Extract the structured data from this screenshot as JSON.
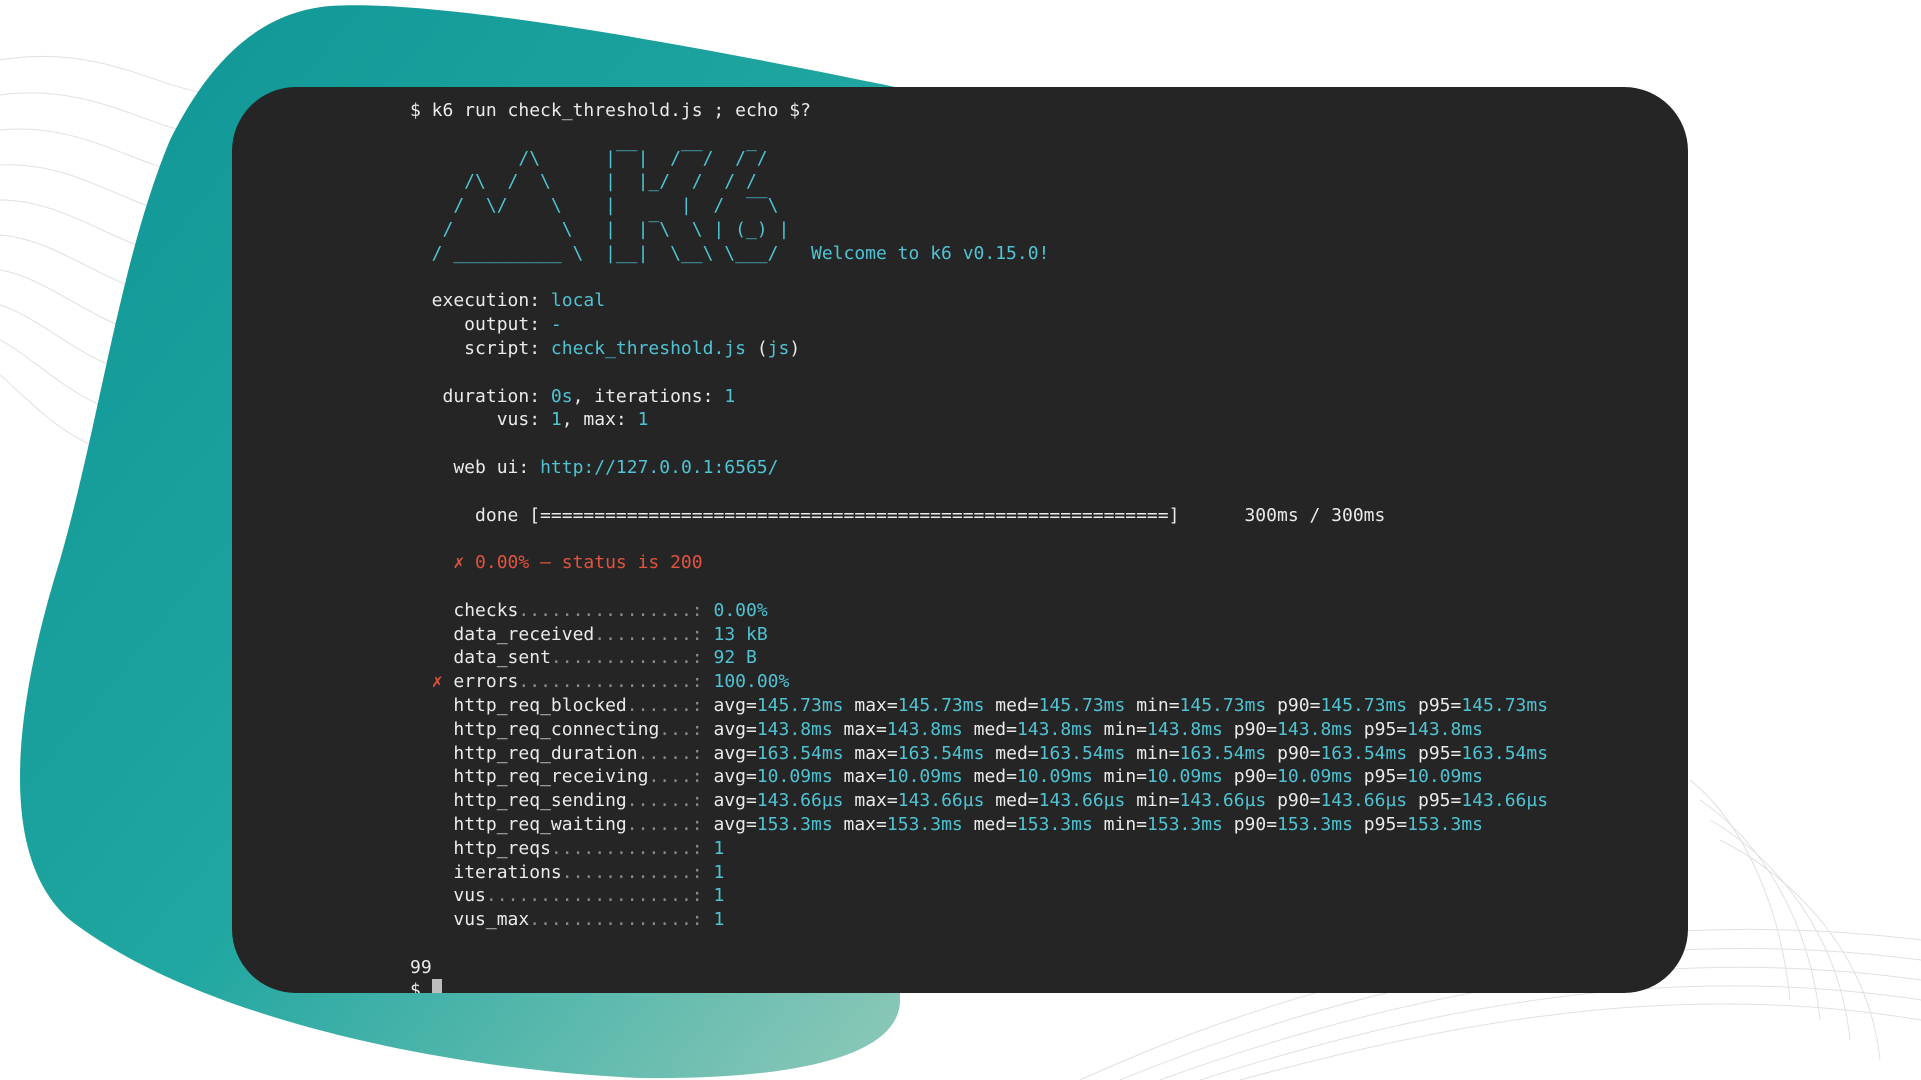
{
  "colors": {
    "terminal_bg": "#252525",
    "text": "#eaeaea",
    "cyan": "#4fc3d3",
    "red": "#e0533e",
    "accent_teal": "#0e9a9a"
  },
  "terminal": {
    "command": "$ k6 run check_threshold.js ; echo $?",
    "logo_lines": [
      "          /\\      |‾‾|  /‾‾/  /‾/",
      "     /\\  /  \\     |  |_/  /  / /",
      "    /  \\/    \\    |      |  /  ‾‾\\",
      "   /          \\   |  |‾\\  \\ | (_) |",
      "  / __________ \\  |__|  \\__\\ \\___/ "
    ],
    "welcome": "Welcome to k6 v0.15.0!",
    "execution": {
      "label": "  execution:",
      "value": "local"
    },
    "output": {
      "label": "     output:",
      "value": "-"
    },
    "script": {
      "label": "     script:",
      "value": "check_threshold.js",
      "suffix_open": "(",
      "suffix_mid": "js",
      "suffix_close": ")"
    },
    "duration": {
      "label": "   duration:",
      "value": "0s",
      "iter_label": ", iterations:",
      "iter_value": "1"
    },
    "vus": {
      "label": "        vus:",
      "value": "1",
      "max_label": ", max:",
      "max_value": "1"
    },
    "webui": {
      "label": "    web ui:",
      "value": "http://127.0.0.1:6565/"
    },
    "progress": {
      "label": "      done",
      "bar": "[==========================================================]",
      "fraction": 1.0,
      "time": "300ms / 300ms"
    },
    "check_fail": "✗ 0.00% – status is 200",
    "metrics": [
      {
        "mark": " ",
        "name": "checks",
        "dots": "................:",
        "value": "0.00%"
      },
      {
        "mark": " ",
        "name": "data_received",
        "dots": ".........:",
        "value": "13 kB"
      },
      {
        "mark": " ",
        "name": "data_sent",
        "dots": ".............:",
        "value": "92 B"
      },
      {
        "mark": "✗",
        "name": "errors",
        "dots": "................:",
        "value": "100.00%"
      },
      {
        "mark": " ",
        "name": "http_req_blocked",
        "dots": "......:",
        "stats": {
          "avg": "145.73ms",
          "max": "145.73ms",
          "med": "145.73ms",
          "min": "145.73ms",
          "p90": "145.73ms",
          "p95": "145.73ms"
        }
      },
      {
        "mark": " ",
        "name": "http_req_connecting",
        "dots": "...:",
        "stats": {
          "avg": "143.8ms",
          "max": "143.8ms",
          "med": "143.8ms",
          "min": "143.8ms",
          "p90": "143.8ms",
          "p95": "143.8ms"
        }
      },
      {
        "mark": " ",
        "name": "http_req_duration",
        "dots": ".....:",
        "stats": {
          "avg": "163.54ms",
          "max": "163.54ms",
          "med": "163.54ms",
          "min": "163.54ms",
          "p90": "163.54ms",
          "p95": "163.54ms"
        }
      },
      {
        "mark": " ",
        "name": "http_req_receiving",
        "dots": "....:",
        "stats": {
          "avg": "10.09ms",
          "max": "10.09ms",
          "med": "10.09ms",
          "min": "10.09ms",
          "p90": "10.09ms",
          "p95": "10.09ms"
        }
      },
      {
        "mark": " ",
        "name": "http_req_sending",
        "dots": "......:",
        "stats": {
          "avg": "143.66µs",
          "max": "143.66µs",
          "med": "143.66µs",
          "min": "143.66µs",
          "p90": "143.66µs",
          "p95": "143.66µs"
        }
      },
      {
        "mark": " ",
        "name": "http_req_waiting",
        "dots": "......:",
        "stats": {
          "avg": "153.3ms",
          "max": "153.3ms",
          "med": "153.3ms",
          "min": "153.3ms",
          "p90": "153.3ms",
          "p95": "153.3ms"
        }
      },
      {
        "mark": " ",
        "name": "http_reqs",
        "dots": ".............:",
        "value": "1"
      },
      {
        "mark": " ",
        "name": "iterations",
        "dots": "............:",
        "value": "1"
      },
      {
        "mark": " ",
        "name": "vus",
        "dots": "...................:",
        "value": "1"
      },
      {
        "mark": " ",
        "name": "vus_max",
        "dots": "...............:",
        "value": "1"
      }
    ],
    "exit_code": "99",
    "prompt": "$"
  }
}
